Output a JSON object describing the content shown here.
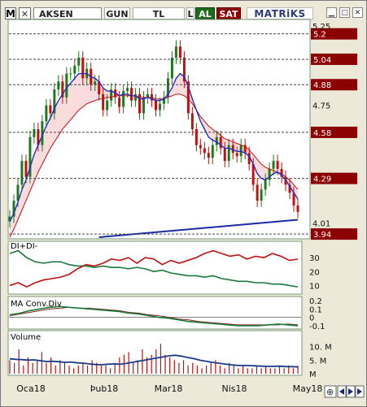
{
  "toolbar": {
    "logo": "M",
    "close_symbol": "✕",
    "ticker": "AKSEN",
    "period": "GUN",
    "currency": "TL",
    "extra": "L",
    "buy_label": "AL",
    "sell_label": "SAT",
    "brand": "MATRiKS",
    "window_icons": [
      "minimize-icon",
      "maximize-icon",
      "close-icon"
    ]
  },
  "colors": {
    "price_up": "#1f7a1f",
    "price_down": "#c01010",
    "ma_fast": "#2030c0",
    "ma_slow": "#c01010",
    "cloud": "#f29a9a",
    "trendline": "#1a2aa0",
    "level_label_bg": "#8b0000",
    "di_plus": "#c01010",
    "di_minus": "#1a7a3a",
    "macd": "#1a7a3a",
    "macd_signal": "#8b1a1a",
    "volume_bar": "#c01010",
    "volume_ma": "#1a3a8a"
  },
  "chart_data": [
    {
      "type": "candlestick",
      "title": "",
      "x_ticks": [
        "Oca18",
        "Þub18",
        "Mar18",
        "Nis18",
        "May18"
      ],
      "y_ticks": [
        5.25,
        4.75,
        4.01
      ],
      "level_lines": [
        5.2,
        5.04,
        4.88,
        4.58,
        4.29,
        3.94
      ],
      "ylim": [
        3.92,
        5.28
      ],
      "grid": false,
      "close": [
        4.05,
        4.15,
        4.25,
        4.4,
        4.3,
        4.55,
        4.6,
        4.5,
        4.65,
        4.75,
        4.7,
        4.85,
        4.9,
        4.8,
        4.95,
        4.95,
        5.0,
        5.05,
        4.92,
        4.98,
        4.88,
        4.9,
        4.82,
        4.72,
        4.78,
        4.85,
        4.8,
        4.74,
        4.84,
        4.86,
        4.78,
        4.82,
        4.7,
        4.8,
        4.82,
        4.78,
        4.72,
        4.76,
        4.8,
        4.92,
        5.05,
        5.12,
        5.05,
        4.9,
        4.7,
        4.6,
        4.5,
        4.48,
        4.45,
        4.42,
        4.5,
        4.55,
        4.48,
        4.4,
        4.5,
        4.45,
        4.43,
        4.5,
        4.45,
        4.38,
        4.25,
        4.15,
        4.22,
        4.28,
        4.35,
        4.4,
        4.35,
        4.3,
        4.25,
        4.2,
        4.12,
        4.08
      ],
      "ma_fast": [
        4.02,
        4.07,
        4.14,
        4.22,
        4.28,
        4.36,
        4.44,
        4.5,
        4.56,
        4.62,
        4.67,
        4.73,
        4.78,
        4.82,
        4.86,
        4.89,
        4.92,
        4.95,
        4.95,
        4.95,
        4.93,
        4.92,
        4.9,
        4.86,
        4.84,
        4.84,
        4.83,
        4.81,
        4.82,
        4.82,
        4.81,
        4.81,
        4.79,
        4.79,
        4.8,
        4.79,
        4.78,
        4.78,
        4.79,
        4.82,
        4.86,
        4.92,
        4.95,
        4.93,
        4.87,
        4.79,
        4.72,
        4.65,
        4.6,
        4.55,
        4.53,
        4.52,
        4.5,
        4.48,
        4.48,
        4.47,
        4.46,
        4.46,
        4.45,
        4.43,
        4.38,
        4.32,
        4.29,
        4.28,
        4.3,
        4.32,
        4.33,
        4.31,
        4.28,
        4.24,
        4.2,
        4.16
      ],
      "ma_slow": [
        3.92,
        3.97,
        4.03,
        4.09,
        4.15,
        4.21,
        4.27,
        4.33,
        4.38,
        4.43,
        4.48,
        4.52,
        4.56,
        4.6,
        4.63,
        4.66,
        4.69,
        4.72,
        4.74,
        4.76,
        4.77,
        4.78,
        4.79,
        4.79,
        4.8,
        4.8,
        4.81,
        4.81,
        4.81,
        4.81,
        4.81,
        4.81,
        4.8,
        4.8,
        4.8,
        4.8,
        4.79,
        4.79,
        4.79,
        4.8,
        4.81,
        4.82,
        4.82,
        4.81,
        4.79,
        4.76,
        4.72,
        4.68,
        4.65,
        4.62,
        4.6,
        4.58,
        4.56,
        4.54,
        4.53,
        4.52,
        4.51,
        4.5,
        4.49,
        4.47,
        4.44,
        4.41,
        4.38,
        4.36,
        4.35,
        4.34,
        4.33,
        4.32,
        4.3,
        4.28,
        4.25,
        4.22
      ],
      "trendline_levels": [
        3.92,
        4.03
      ]
    },
    {
      "type": "line",
      "title": "DI+DI-",
      "y_ticks": [
        30,
        20,
        10
      ],
      "ylim": [
        5,
        40
      ],
      "series": [
        {
          "name": "",
          "values": [
            33,
            35,
            30,
            27,
            26,
            27,
            27,
            25,
            24,
            24,
            23,
            24,
            23,
            23,
            22,
            23,
            22,
            20,
            21,
            19,
            18,
            17,
            17,
            16,
            17,
            15,
            14,
            13,
            13,
            12,
            12,
            11,
            11,
            10,
            9
          ]
        },
        {
          "name": "",
          "values": [
            10,
            12,
            9,
            12,
            14,
            15,
            16,
            18,
            22,
            25,
            24,
            26,
            29,
            28,
            30,
            26,
            30,
            29,
            25,
            28,
            26,
            28,
            30,
            33,
            35,
            33,
            31,
            32,
            29,
            31,
            30,
            33,
            31,
            28,
            29
          ]
        }
      ]
    },
    {
      "type": "line",
      "title": "MA Conv.Div",
      "y_ticks": [
        0.2,
        0.1,
        0,
        -0.1
      ],
      "ylim": [
        -0.12,
        0.22
      ],
      "series": [
        {
          "name": "",
          "values": [
            0.03,
            0.05,
            0.08,
            0.1,
            0.12,
            0.13,
            0.12,
            0.11,
            0.1,
            0.09,
            0.08,
            0.07,
            0.05,
            0.04,
            0.02,
            0.0,
            -0.01,
            -0.03,
            -0.05,
            -0.06,
            -0.07,
            -0.08,
            -0.09,
            -0.1,
            -0.1,
            -0.1,
            -0.09,
            -0.08,
            -0.09,
            -0.1
          ]
        },
        {
          "name": "",
          "values": [
            0.02,
            0.04,
            0.06,
            0.08,
            0.1,
            0.11,
            0.12,
            0.11,
            0.11,
            0.1,
            0.09,
            0.08,
            0.06,
            0.05,
            0.03,
            0.02,
            0.0,
            -0.02,
            -0.03,
            -0.05,
            -0.06,
            -0.07,
            -0.08,
            -0.09,
            -0.09,
            -0.09,
            -0.09,
            -0.09,
            -0.08,
            -0.09
          ]
        }
      ]
    },
    {
      "type": "bar",
      "title": "Volume",
      "y_ticks": [
        "10. M",
        "5. M",
        "M"
      ],
      "ylim": [
        0,
        12
      ],
      "values": [
        5,
        4,
        9,
        3,
        6,
        4,
        5,
        8,
        4,
        6,
        3,
        5,
        4,
        3,
        2,
        3,
        4,
        3,
        5,
        4,
        3,
        3,
        2,
        4,
        6,
        7,
        8,
        4,
        5,
        9,
        6,
        7,
        9,
        11,
        7,
        6,
        5,
        4,
        5,
        3,
        4,
        3,
        2,
        3,
        4,
        5,
        3,
        2,
        4,
        3,
        2,
        3,
        2,
        2,
        3,
        2,
        3,
        2,
        2,
        3,
        2,
        3,
        2,
        3
      ],
      "series": [
        {
          "name": "",
          "values": [
            5.5,
            5.3,
            5.2,
            5.0,
            5.1,
            4.8,
            4.5,
            4.6,
            4.4,
            4.2,
            4.3,
            4.0,
            3.9,
            3.6,
            3.4,
            3.3,
            3.5,
            3.6,
            3.5,
            3.8,
            4.2,
            4.6,
            5.0,
            5.4,
            5.8,
            6.2,
            6.6,
            6.8,
            6.5,
            6.0,
            5.6,
            5.0,
            4.6,
            4.2,
            3.9,
            3.6,
            3.3,
            3.1,
            3.0,
            3.0,
            2.9,
            2.8,
            2.7,
            2.7,
            2.8,
            2.6,
            2.6,
            2.5
          ]
        }
      ]
    }
  ]
}
